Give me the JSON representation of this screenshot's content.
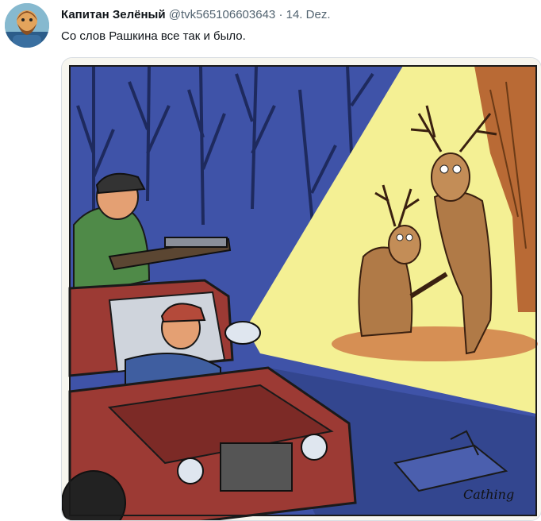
{
  "tweet": {
    "author_name": "Капитан Зелёный",
    "handle": "@tvk565106603643",
    "separator": "·",
    "date": "14. Dez.",
    "text": "Со слов Рашкина все так и было."
  },
  "media": {
    "type": "cartoon",
    "signature": "Cathing"
  },
  "colors": {
    "night_blue": "#3f53a8",
    "light_beam": "#f4f094",
    "car_red": "#9c3a34",
    "hunter_shirt": "#4f8a48",
    "deer_brown": "#b07a47"
  }
}
